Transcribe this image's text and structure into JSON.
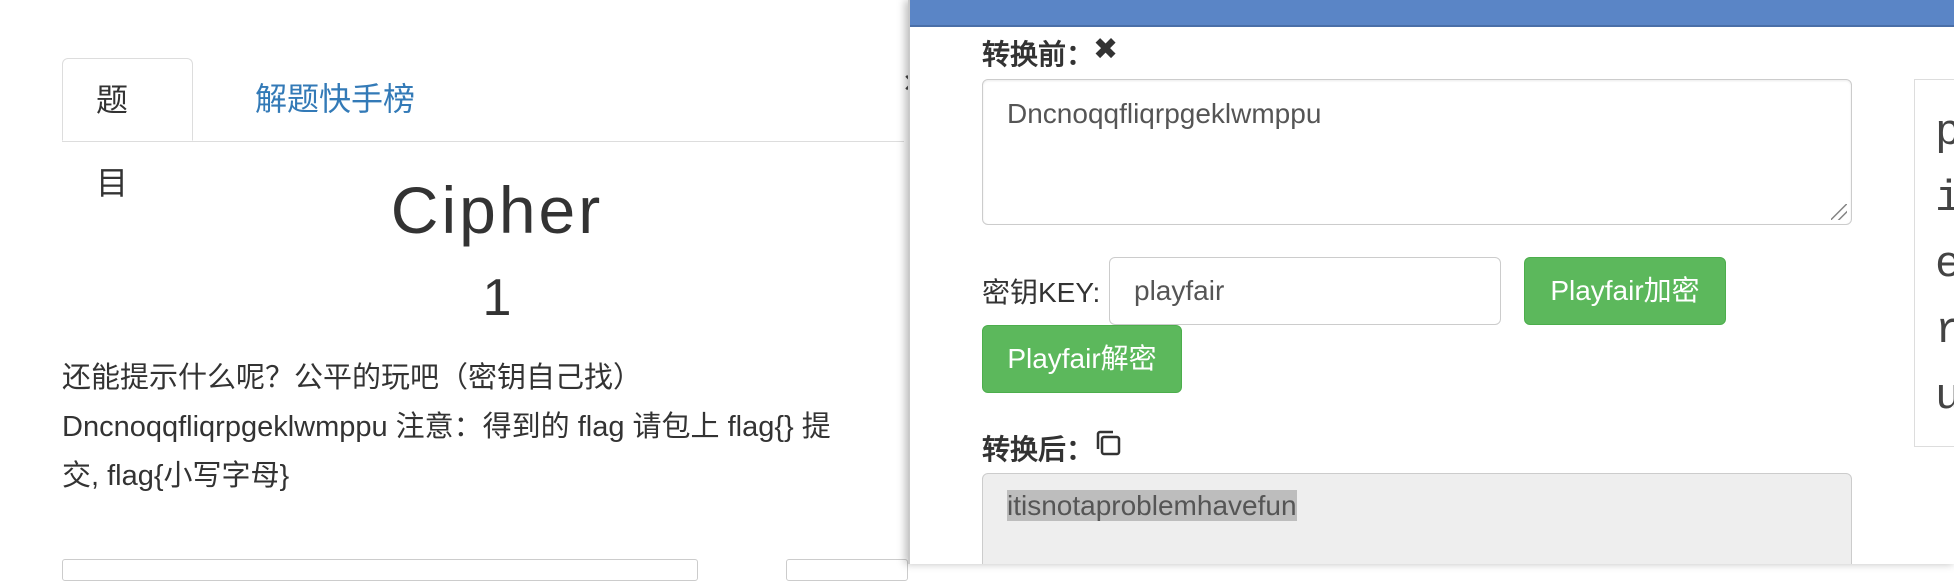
{
  "tabs": [
    {
      "label": "题目",
      "active": true
    },
    {
      "label": "解题快手榜",
      "active": false
    }
  ],
  "challenge": {
    "title": "Cipher",
    "points": "1",
    "description_lines": [
      "还能提示什么呢？公平的玩吧（密钥自己找）",
      "Dncnoqqfliqrpgeklwmppu 注意：得到的 flag 请包上 flag{} 提",
      "交, flag{小写字母}"
    ]
  },
  "tool": {
    "before_label": "转换前：",
    "input_value": "Dncnoqqfliqrpgeklwmppu",
    "key_label": "密钥KEY:",
    "key_value": "playfair",
    "encrypt_button": "Playfair加密",
    "decrypt_button": "Playfair解密",
    "after_label": "转换后：",
    "output_value": "itisnotaproblemhavefun",
    "side_chars": [
      "p",
      "i",
      "e",
      "r",
      "u"
    ]
  },
  "colors": {
    "header_blue": "#5a85c6",
    "button_green": "#5cb85c",
    "link_blue": "#337ab7"
  },
  "icons": [
    "close-icon",
    "clear-icon",
    "copy-icon"
  ]
}
